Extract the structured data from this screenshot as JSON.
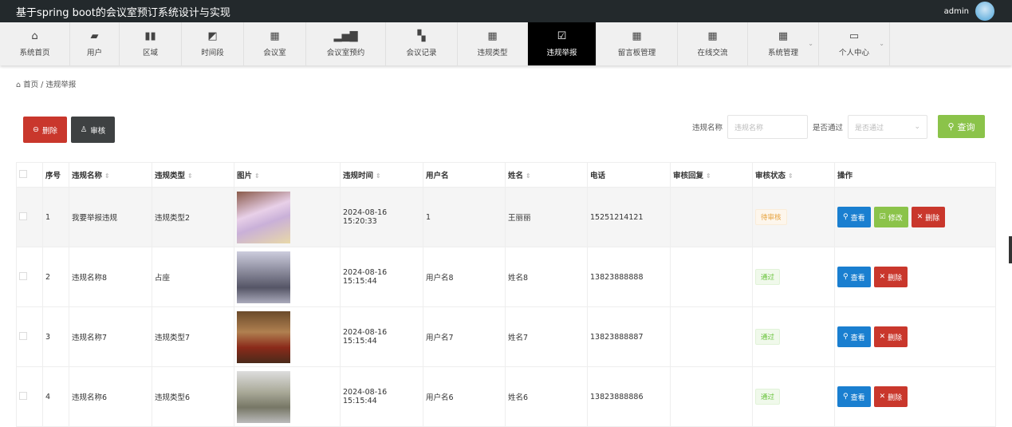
{
  "app": {
    "title": "基于spring boot的会议室预订系统设计与实现",
    "user": "admin"
  },
  "nav": [
    {
      "label": "系统首页",
      "icon": "home-icon",
      "glyph": "⌂"
    },
    {
      "label": "用户",
      "icon": "wallet-icon",
      "glyph": "▰"
    },
    {
      "label": "区域",
      "icon": "book-icon",
      "glyph": "▮▮"
    },
    {
      "label": "时间段",
      "icon": "chart-line-icon",
      "glyph": "◩"
    },
    {
      "label": "会议室",
      "icon": "grid-icon",
      "glyph": "▦"
    },
    {
      "label": "会议室预约",
      "icon": "bar-chart-icon",
      "glyph": "▂▅▇"
    },
    {
      "label": "会议记录",
      "icon": "ticket-icon",
      "glyph": "▚"
    },
    {
      "label": "违规类型",
      "icon": "grid-icon",
      "glyph": "▦"
    },
    {
      "label": "违规举报",
      "icon": "clipboard-check-icon",
      "glyph": "☑"
    },
    {
      "label": "留言板管理",
      "icon": "grid-icon",
      "glyph": "▦"
    },
    {
      "label": "在线交流",
      "icon": "grid-icon",
      "glyph": "▦"
    },
    {
      "label": "系统管理",
      "icon": "grid-icon",
      "glyph": "▦"
    },
    {
      "label": "个人中心",
      "icon": "wallet-card-icon",
      "glyph": "▭"
    }
  ],
  "breadcrumb": {
    "home": "首页",
    "sep": "/",
    "current": "违规举报"
  },
  "toolbar": {
    "delete": "删除",
    "audit": "审核"
  },
  "search": {
    "name_label": "违规名称",
    "name_placeholder": "违规名称",
    "pass_label": "是否通过",
    "pass_placeholder": "是否通过",
    "query": "查询"
  },
  "table": {
    "headers": [
      "序号",
      "违规名称",
      "违规类型",
      "图片",
      "违规时间",
      "用户名",
      "姓名",
      "电话",
      "审核回复",
      "审核状态",
      "操作"
    ],
    "rows": [
      {
        "no": "1",
        "name": "我要举报违规",
        "type": "违规类型2",
        "time": "2024-08-16 15:20:33",
        "username": "1",
        "realname": "王丽丽",
        "phone": "15251214121",
        "reply": "",
        "status": "待审核",
        "status_kind": "pending",
        "can_edit": true
      },
      {
        "no": "2",
        "name": "违规名称8",
        "type": "占座",
        "time": "2024-08-16 15:15:44",
        "username": "用户名8",
        "realname": "姓名8",
        "phone": "13823888888",
        "reply": "",
        "status": "通过",
        "status_kind": "pass",
        "can_edit": false
      },
      {
        "no": "3",
        "name": "违规名称7",
        "type": "违规类型7",
        "time": "2024-08-16 15:15:44",
        "username": "用户名7",
        "realname": "姓名7",
        "phone": "13823888887",
        "reply": "",
        "status": "通过",
        "status_kind": "pass",
        "can_edit": false
      },
      {
        "no": "4",
        "name": "违规名称6",
        "type": "违规类型6",
        "time": "2024-08-16 15:15:44",
        "username": "用户名6",
        "realname": "姓名6",
        "phone": "13823888886",
        "reply": "",
        "status": "通过",
        "status_kind": "pass",
        "can_edit": false
      }
    ],
    "actions": {
      "view": "查看",
      "edit": "修改",
      "delete": "删除"
    }
  }
}
